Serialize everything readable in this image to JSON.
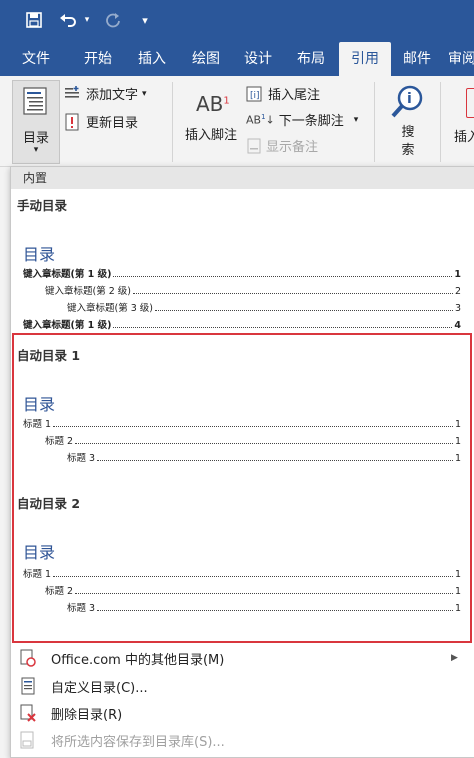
{
  "tabs": {
    "file": "文件",
    "home": "开始",
    "insert": "插入",
    "draw": "绘图",
    "design": "设计",
    "layout": "布局",
    "references": "引用",
    "mailings": "邮件",
    "review": "审阅"
  },
  "ribbon": {
    "toc": "目录",
    "add_text": "添加文字",
    "update_toc": "更新目录",
    "insert_footnote": "插入脚注",
    "insert_endnote": "插入尾注",
    "next_footnote": "下一条脚注",
    "show_notes": "显示备注",
    "search_line1": "搜",
    "search_line2": "索",
    "insert_partial": "插入",
    "ab_label": "AB",
    "ab_sup": "1"
  },
  "panel": {
    "section": "内置",
    "manual": {
      "title": "手动目录",
      "heading": "目录",
      "lines": [
        {
          "text": "键入章标题(第 1 级)",
          "num": "1"
        },
        {
          "text": "键入章标题(第 2 级)",
          "num": "2"
        },
        {
          "text": "键入章标题(第 3 级)",
          "num": "3"
        },
        {
          "text": "键入章标题(第 1 级)",
          "num": "4"
        }
      ]
    },
    "auto1": {
      "title": "自动目录 1",
      "heading": "目录",
      "lines": [
        {
          "text": "标题 1",
          "num": "1"
        },
        {
          "text": "标题 2",
          "num": "1"
        },
        {
          "text": "标题 3",
          "num": "1"
        }
      ]
    },
    "auto2": {
      "title": "自动目录 2",
      "heading": "目录",
      "lines": [
        {
          "text": "标题 1",
          "num": "1"
        },
        {
          "text": "标题 2",
          "num": "1"
        },
        {
          "text": "标题 3",
          "num": "1"
        }
      ]
    },
    "menu": {
      "office": "Office.com 中的其他目录(M)",
      "custom": "自定义目录(C)...",
      "remove": "删除目录(R)",
      "save": "将所选内容保存到目录库(S)..."
    }
  },
  "colors": {
    "ribbon_blue": "#2b579a",
    "heading_blue": "#2f5496",
    "highlight_red": "#d9363e"
  }
}
